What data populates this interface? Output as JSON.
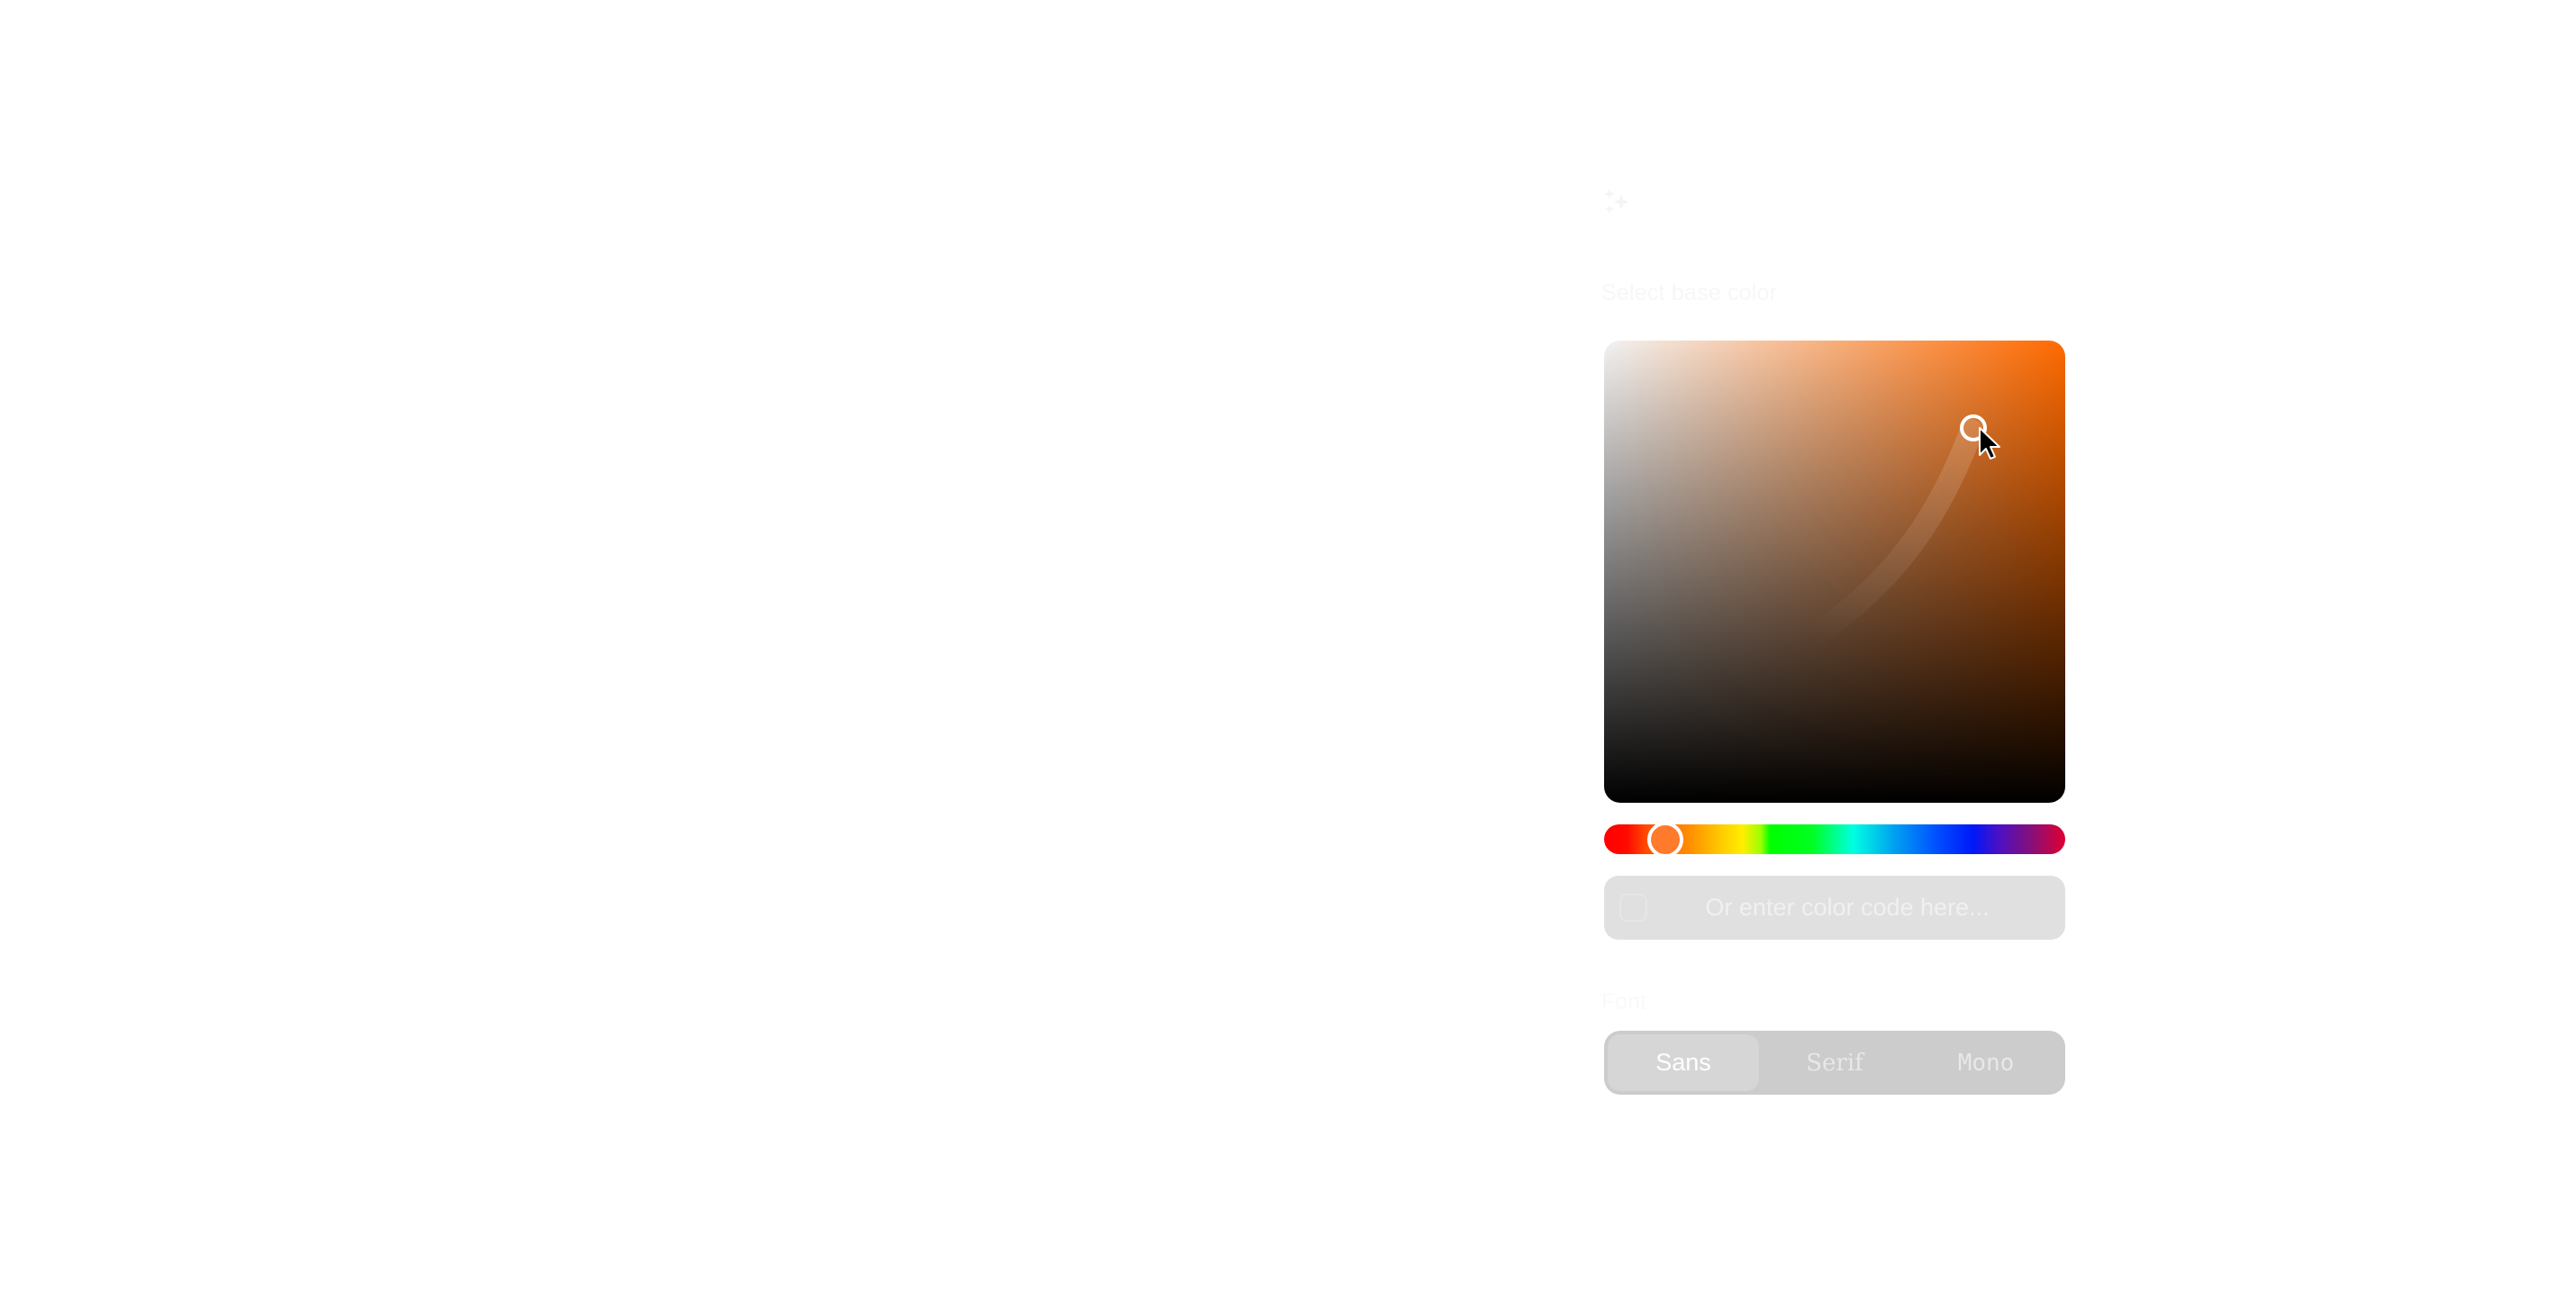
{
  "panel": {
    "icon": "sparkles-icon",
    "title": "Select base color",
    "color_picker": {
      "hue_degrees": 24,
      "saturation": 0.8,
      "value": 0.81,
      "hue_color": "#ff6a00",
      "thumb_color": "#ff7a2a",
      "hue_fraction": 0.133
    },
    "color_code_input": {
      "value": "",
      "placeholder": "Or enter color code here...",
      "swatch_icon": "color-swatch-icon"
    },
    "font": {
      "label": "Font",
      "options": [
        {
          "label": "Sans",
          "active": true
        },
        {
          "label": "Serif",
          "active": false
        },
        {
          "label": "Mono",
          "active": false
        }
      ]
    }
  }
}
